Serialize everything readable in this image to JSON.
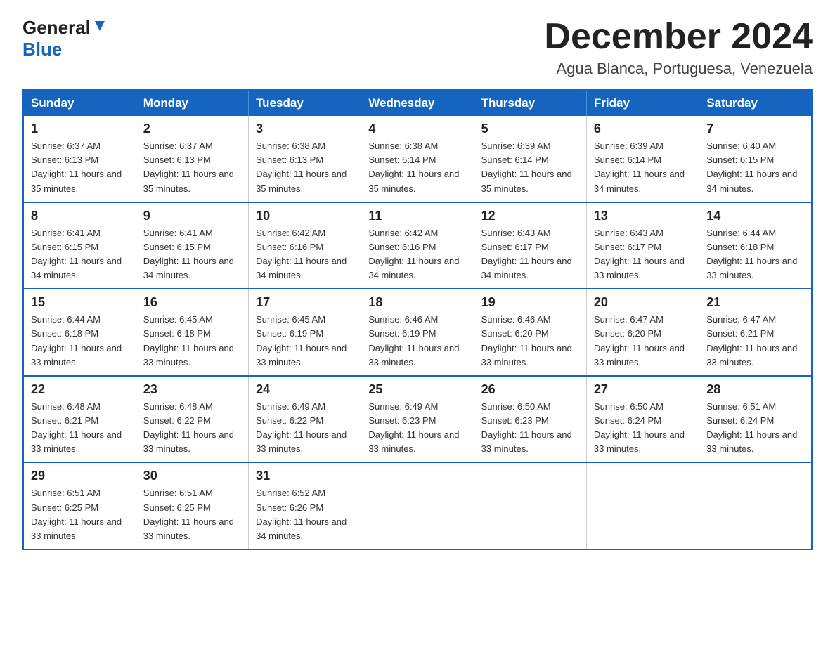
{
  "header": {
    "logo_general": "General",
    "logo_blue": "Blue",
    "month_title": "December 2024",
    "location": "Agua Blanca, Portuguesa, Venezuela"
  },
  "weekdays": [
    "Sunday",
    "Monday",
    "Tuesday",
    "Wednesday",
    "Thursday",
    "Friday",
    "Saturday"
  ],
  "weeks": [
    [
      {
        "day": "1",
        "sunrise": "6:37 AM",
        "sunset": "6:13 PM",
        "daylight": "11 hours and 35 minutes."
      },
      {
        "day": "2",
        "sunrise": "6:37 AM",
        "sunset": "6:13 PM",
        "daylight": "11 hours and 35 minutes."
      },
      {
        "day": "3",
        "sunrise": "6:38 AM",
        "sunset": "6:13 PM",
        "daylight": "11 hours and 35 minutes."
      },
      {
        "day": "4",
        "sunrise": "6:38 AM",
        "sunset": "6:14 PM",
        "daylight": "11 hours and 35 minutes."
      },
      {
        "day": "5",
        "sunrise": "6:39 AM",
        "sunset": "6:14 PM",
        "daylight": "11 hours and 35 minutes."
      },
      {
        "day": "6",
        "sunrise": "6:39 AM",
        "sunset": "6:14 PM",
        "daylight": "11 hours and 34 minutes."
      },
      {
        "day": "7",
        "sunrise": "6:40 AM",
        "sunset": "6:15 PM",
        "daylight": "11 hours and 34 minutes."
      }
    ],
    [
      {
        "day": "8",
        "sunrise": "6:41 AM",
        "sunset": "6:15 PM",
        "daylight": "11 hours and 34 minutes."
      },
      {
        "day": "9",
        "sunrise": "6:41 AM",
        "sunset": "6:15 PM",
        "daylight": "11 hours and 34 minutes."
      },
      {
        "day": "10",
        "sunrise": "6:42 AM",
        "sunset": "6:16 PM",
        "daylight": "11 hours and 34 minutes."
      },
      {
        "day": "11",
        "sunrise": "6:42 AM",
        "sunset": "6:16 PM",
        "daylight": "11 hours and 34 minutes."
      },
      {
        "day": "12",
        "sunrise": "6:43 AM",
        "sunset": "6:17 PM",
        "daylight": "11 hours and 34 minutes."
      },
      {
        "day": "13",
        "sunrise": "6:43 AM",
        "sunset": "6:17 PM",
        "daylight": "11 hours and 33 minutes."
      },
      {
        "day": "14",
        "sunrise": "6:44 AM",
        "sunset": "6:18 PM",
        "daylight": "11 hours and 33 minutes."
      }
    ],
    [
      {
        "day": "15",
        "sunrise": "6:44 AM",
        "sunset": "6:18 PM",
        "daylight": "11 hours and 33 minutes."
      },
      {
        "day": "16",
        "sunrise": "6:45 AM",
        "sunset": "6:18 PM",
        "daylight": "11 hours and 33 minutes."
      },
      {
        "day": "17",
        "sunrise": "6:45 AM",
        "sunset": "6:19 PM",
        "daylight": "11 hours and 33 minutes."
      },
      {
        "day": "18",
        "sunrise": "6:46 AM",
        "sunset": "6:19 PM",
        "daylight": "11 hours and 33 minutes."
      },
      {
        "day": "19",
        "sunrise": "6:46 AM",
        "sunset": "6:20 PM",
        "daylight": "11 hours and 33 minutes."
      },
      {
        "day": "20",
        "sunrise": "6:47 AM",
        "sunset": "6:20 PM",
        "daylight": "11 hours and 33 minutes."
      },
      {
        "day": "21",
        "sunrise": "6:47 AM",
        "sunset": "6:21 PM",
        "daylight": "11 hours and 33 minutes."
      }
    ],
    [
      {
        "day": "22",
        "sunrise": "6:48 AM",
        "sunset": "6:21 PM",
        "daylight": "11 hours and 33 minutes."
      },
      {
        "day": "23",
        "sunrise": "6:48 AM",
        "sunset": "6:22 PM",
        "daylight": "11 hours and 33 minutes."
      },
      {
        "day": "24",
        "sunrise": "6:49 AM",
        "sunset": "6:22 PM",
        "daylight": "11 hours and 33 minutes."
      },
      {
        "day": "25",
        "sunrise": "6:49 AM",
        "sunset": "6:23 PM",
        "daylight": "11 hours and 33 minutes."
      },
      {
        "day": "26",
        "sunrise": "6:50 AM",
        "sunset": "6:23 PM",
        "daylight": "11 hours and 33 minutes."
      },
      {
        "day": "27",
        "sunrise": "6:50 AM",
        "sunset": "6:24 PM",
        "daylight": "11 hours and 33 minutes."
      },
      {
        "day": "28",
        "sunrise": "6:51 AM",
        "sunset": "6:24 PM",
        "daylight": "11 hours and 33 minutes."
      }
    ],
    [
      {
        "day": "29",
        "sunrise": "6:51 AM",
        "sunset": "6:25 PM",
        "daylight": "11 hours and 33 minutes."
      },
      {
        "day": "30",
        "sunrise": "6:51 AM",
        "sunset": "6:25 PM",
        "daylight": "11 hours and 33 minutes."
      },
      {
        "day": "31",
        "sunrise": "6:52 AM",
        "sunset": "6:26 PM",
        "daylight": "11 hours and 34 minutes."
      },
      null,
      null,
      null,
      null
    ]
  ]
}
